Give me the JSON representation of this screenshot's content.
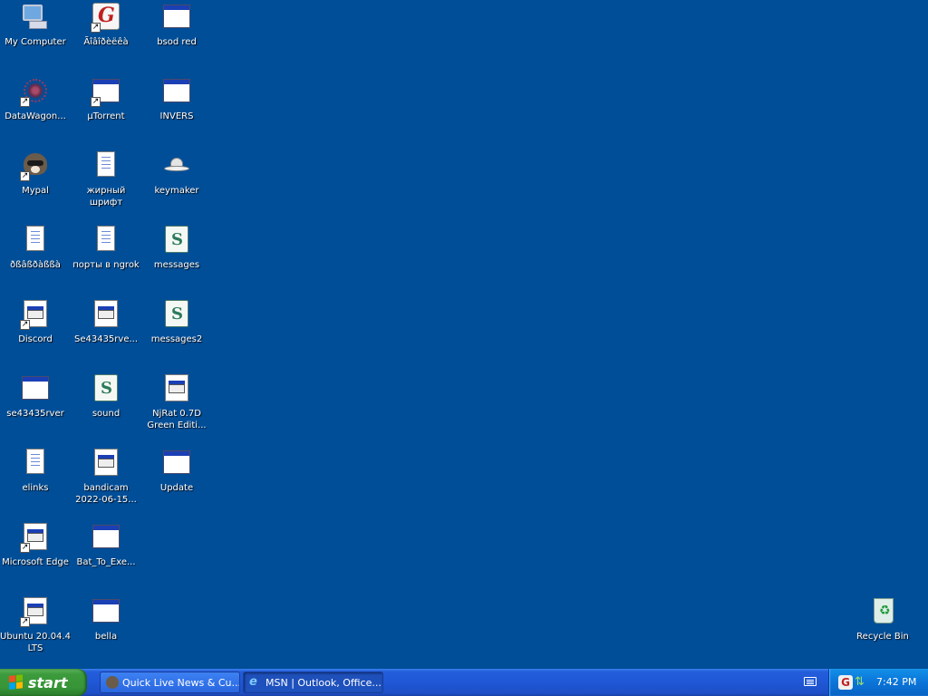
{
  "desktop": {
    "icons": [
      {
        "label": "My Computer"
      },
      {
        "label": "Ãîâîðèëêà"
      },
      {
        "label": "bsod red"
      },
      {
        "label": "DataWagon..."
      },
      {
        "label": "µTorrent"
      },
      {
        "label": "INVERS"
      },
      {
        "label": "Mypal"
      },
      {
        "label": "жирный шрифт"
      },
      {
        "label": "keymaker"
      },
      {
        "label": "ðßâßðàßßà"
      },
      {
        "label": "порты в ngrok"
      },
      {
        "label": "messages"
      },
      {
        "label": "Discord"
      },
      {
        "label": "Se43435rve..."
      },
      {
        "label": "messages2"
      },
      {
        "label": "se43435rver"
      },
      {
        "label": "sound"
      },
      {
        "label": "NjRat 0.7D Green Editi..."
      },
      {
        "label": "elinks"
      },
      {
        "label": "bandicam 2022-06-15..."
      },
      {
        "label": "Update"
      },
      {
        "label": "Microsoft Edge"
      },
      {
        "label": "Bat_To_Exe..."
      },
      {
        "label": "Ubuntu 20.04.4 LTS"
      },
      {
        "label": "bella"
      },
      {
        "label": "Recycle Bin"
      }
    ]
  },
  "taskbar": {
    "start_label": "start",
    "tasks": [
      {
        "label": "Quick Live News & Cu..."
      },
      {
        "label": "MSN | Outlook, Office..."
      }
    ],
    "clock": "7:42 PM"
  },
  "colors": {
    "desktop_bg": "#004e98",
    "taskbar_blue": "#245edb",
    "start_green": "#3c9b3c",
    "tray_blue": "#0b74d8"
  }
}
